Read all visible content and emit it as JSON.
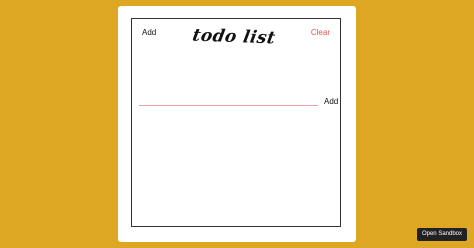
{
  "app": {
    "title": "todo list",
    "add_label": "Add",
    "clear_label": "Clear"
  },
  "input": {
    "value": "",
    "placeholder": "",
    "add_label": "Add"
  },
  "sandbox": {
    "button_label": "Open Sandbox"
  },
  "colors": {
    "background": "#DDA723",
    "clear_accent": "#e8534e",
    "input_underline": "#e9a59f"
  }
}
